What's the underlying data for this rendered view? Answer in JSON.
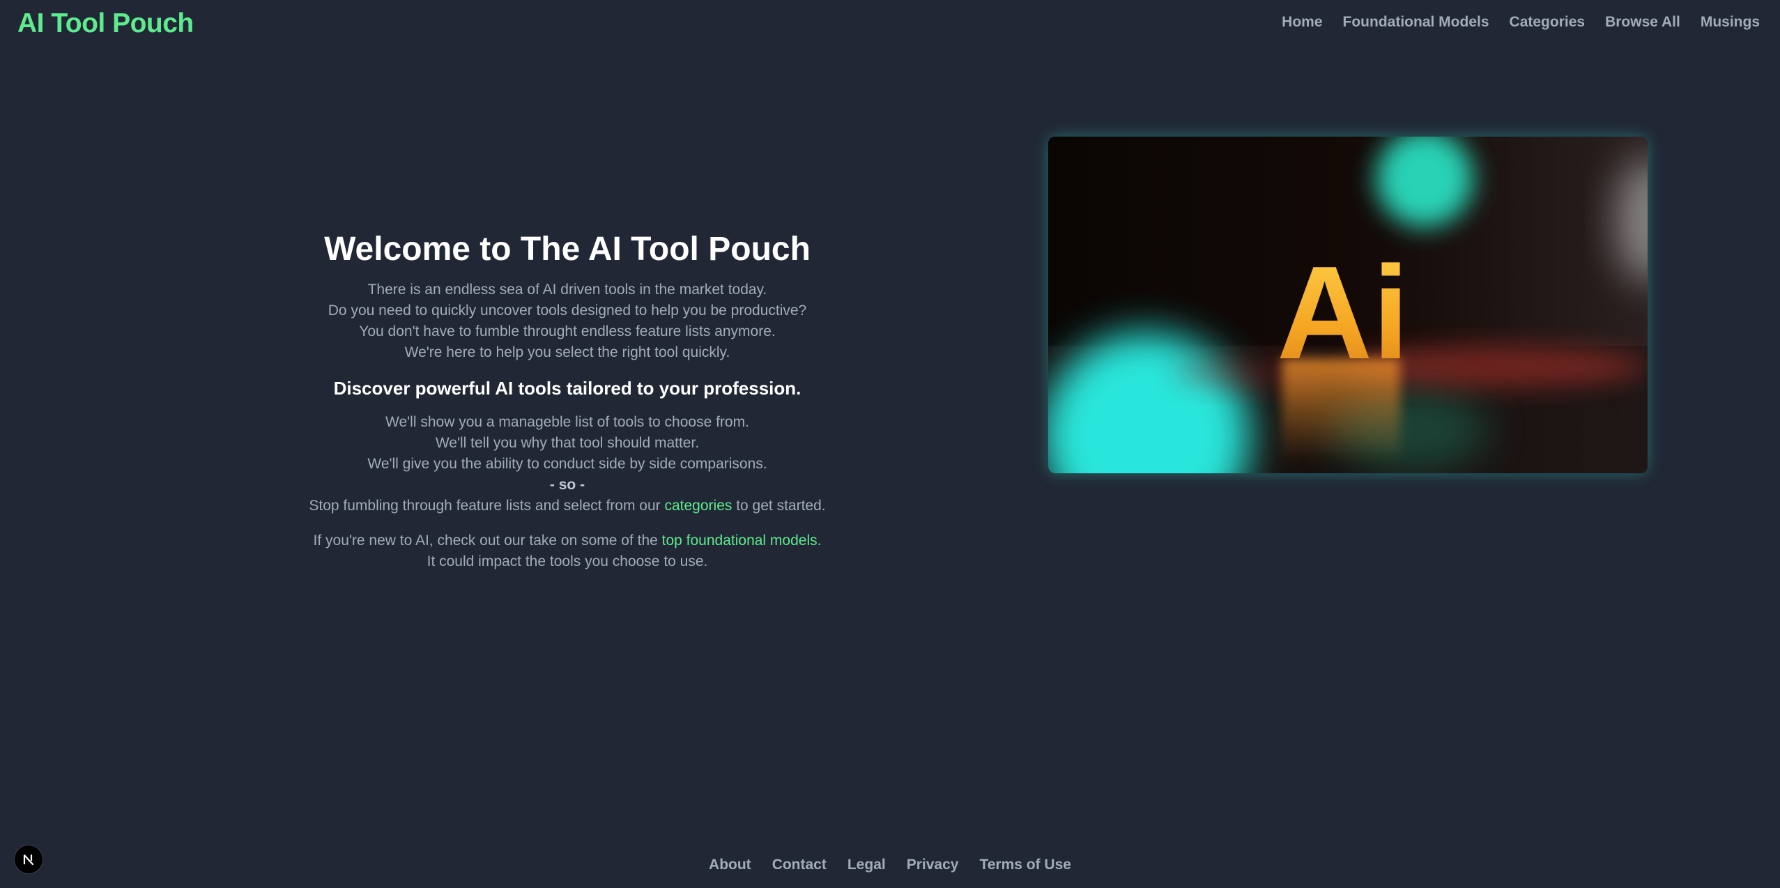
{
  "header": {
    "logo": "AI Tool Pouch",
    "nav": [
      {
        "label": "Home"
      },
      {
        "label": "Foundational Models"
      },
      {
        "label": "Categories"
      },
      {
        "label": "Browse All"
      },
      {
        "label": "Musings"
      }
    ]
  },
  "hero": {
    "title": "Welcome to The AI Tool Pouch",
    "intro_lines": [
      "There is an endless sea of AI driven tools in the market today.",
      "Do you need to quickly uncover tools designed to help you be productive?",
      "You don't have to fumble throught endless feature lists anymore.",
      "We're here to help you select the right tool quickly."
    ],
    "subtitle": "Discover powerful AI tools tailored to your profession.",
    "promise_lines": [
      "We'll show you a manageble list of tools to choose from.",
      "We'll tell you why that tool should matter.",
      "We'll give you the ability to conduct side by side comparisons."
    ],
    "so": "- so -",
    "cta_prefix": "Stop fumbling through feature lists and select from our ",
    "cta_link": "categories",
    "cta_suffix": " to get started.",
    "models_prefix": "If you're new to AI, check out our take on some of the ",
    "models_link": "top foundational models.",
    "models_line2": "It could impact the tools you choose to use."
  },
  "image": {
    "text": "Ai"
  },
  "footer": {
    "links": [
      {
        "label": "About"
      },
      {
        "label": "Contact"
      },
      {
        "label": "Legal"
      },
      {
        "label": "Privacy"
      },
      {
        "label": "Terms of Use"
      }
    ]
  },
  "badge": {
    "icon": "next-logo-icon"
  },
  "colors": {
    "background": "#212734",
    "accent": "#5eeb8f",
    "text_muted": "#a3acb9",
    "heading": "#ffffff"
  }
}
